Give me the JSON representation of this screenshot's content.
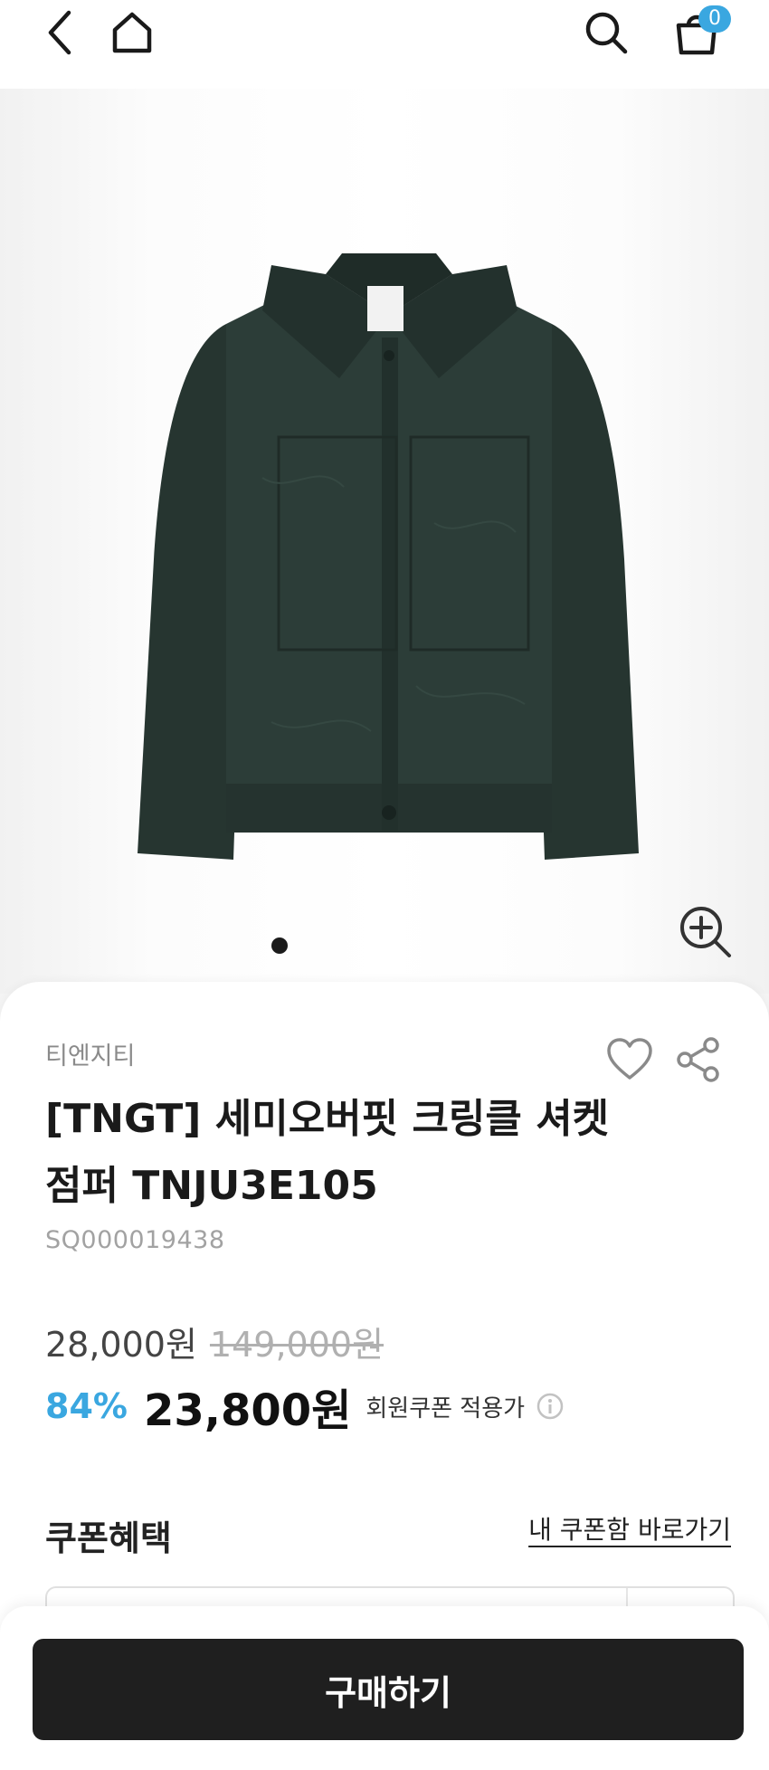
{
  "header": {
    "icons": [
      "chevron-left-icon",
      "home-icon",
      "search-icon",
      "shopping-bag-icon"
    ],
    "cart_count": "0",
    "badge_color": "#3aa7e0"
  },
  "gallery": {
    "image": "dark-green-jacket",
    "slide_count": 1,
    "current_slide": 1,
    "zoom_icon": "zoom-in-icon"
  },
  "product": {
    "brand": "티엔지티",
    "title": "[TNGT] 세미오버핏 크링클 셔켓 점퍼 TNJU3E105",
    "sku": "SQ000019438",
    "sale_price": "28,000원",
    "original_price": "149,000원",
    "discount_rate": "84%",
    "final_price": "23,800원",
    "coupon_note": "회원쿠폰 적용가",
    "accent_color": "#3aa7e0"
  },
  "coupon": {
    "title": "쿠폰혜택",
    "link_label": "내 쿠폰함 바로가기"
  },
  "actions": {
    "buy_label": "구매하기"
  }
}
